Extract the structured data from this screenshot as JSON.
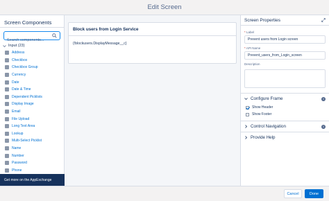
{
  "header": {
    "title": "Edit Screen"
  },
  "left_panel": {
    "title": "Screen Components",
    "search_placeholder": "Search components...",
    "section_label": "Input (23)",
    "items": [
      "Address",
      "Checkbox",
      "Checkbox Group",
      "Currency",
      "Date",
      "Date & Time",
      "Dependent Picklists",
      "Display Image",
      "Email",
      "File Upload",
      "Long Text Area",
      "Lookup",
      "Multi-Select Picklist",
      "Name",
      "Number",
      "Password",
      "Phone"
    ],
    "appexchange": "Get more on the AppExchange"
  },
  "canvas": {
    "card_title": "Block users from Login Service",
    "card_body": "{!blockusers.DisplayMessage__c}"
  },
  "right_panel": {
    "title": "Screen Properties",
    "label_field": {
      "label": "Label",
      "value": "Prevent users from Login screen"
    },
    "api_field": {
      "label": "API Name",
      "value": "Prevent_users_from_Login_screen"
    },
    "description_label": "Description",
    "configure_frame": "Configure Frame",
    "show_header": "Show Header",
    "show_footer": "Show Footer",
    "control_navigation": "Control Navigation",
    "provide_help": "Provide Help"
  },
  "footer": {
    "cancel": "Cancel",
    "done": "Done"
  },
  "colors": {
    "accent": "#0070d2",
    "navy": "#16325c",
    "border": "#d8dde6"
  }
}
